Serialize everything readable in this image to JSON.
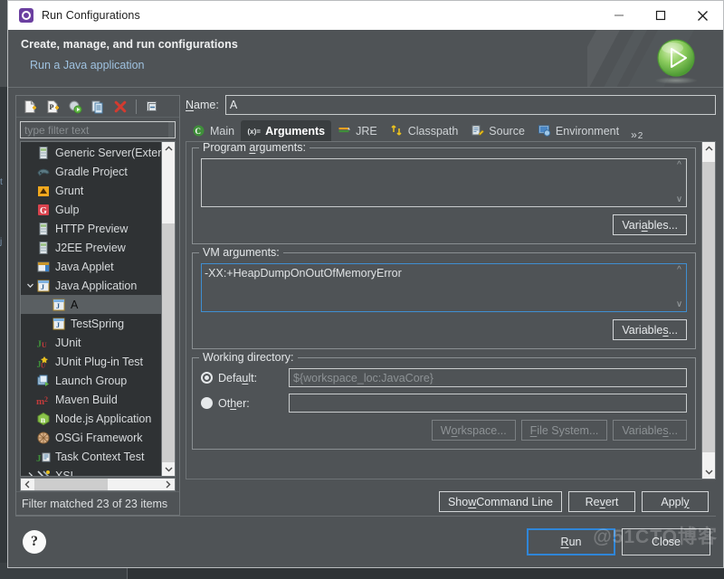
{
  "window": {
    "title": "Run Configurations",
    "icon": "run-configurations-icon",
    "minimize": "minimize-icon",
    "maximize": "maximize-icon",
    "close": "close-icon"
  },
  "header": {
    "title": "Create, manage, and run configurations",
    "subtitle": "Run a Java application",
    "badge_icon": "green-run-icon"
  },
  "left_panel": {
    "toolbar": [
      {
        "name": "new-launch-configuration",
        "icon": "new-config-icon"
      },
      {
        "name": "new-prototype",
        "icon": "new-prototype-icon"
      },
      {
        "name": "export-launch-configuration",
        "icon": "export-icon"
      },
      {
        "name": "duplicate-launch-configuration",
        "icon": "duplicate-icon"
      },
      {
        "name": "delete-launch-configuration",
        "icon": "delete-icon"
      },
      {
        "name": "collapse-all",
        "icon": "collapse-all-icon"
      }
    ],
    "filter": {
      "value": "",
      "placeholder": "type filter text"
    },
    "tree": [
      {
        "label": "Generic Server(External Launch)",
        "icon": "server-icon",
        "indent": 0,
        "twisty": "",
        "selected": false
      },
      {
        "label": "Gradle Project",
        "icon": "gradle-icon",
        "indent": 0,
        "twisty": "",
        "selected": false
      },
      {
        "label": "Grunt",
        "icon": "grunt-icon",
        "indent": 0,
        "twisty": "",
        "selected": false
      },
      {
        "label": "Gulp",
        "icon": "gulp-icon",
        "indent": 0,
        "twisty": "",
        "selected": false
      },
      {
        "label": "HTTP Preview",
        "icon": "server-icon",
        "indent": 0,
        "twisty": "",
        "selected": false
      },
      {
        "label": "J2EE Preview",
        "icon": "server-icon",
        "indent": 0,
        "twisty": "",
        "selected": false
      },
      {
        "label": "Java Applet",
        "icon": "java-applet-icon",
        "indent": 0,
        "twisty": "",
        "selected": false
      },
      {
        "label": "Java Application",
        "icon": "java-application-icon",
        "indent": 0,
        "twisty": "expanded",
        "selected": false
      },
      {
        "label": "A",
        "icon": "java-launch-icon",
        "indent": 1,
        "twisty": "",
        "selected": true
      },
      {
        "label": "TestSpring",
        "icon": "java-launch-icon",
        "indent": 1,
        "twisty": "",
        "selected": false
      },
      {
        "label": "JUnit",
        "icon": "junit-icon",
        "indent": 0,
        "twisty": "",
        "selected": false
      },
      {
        "label": "JUnit Plug-in Test",
        "icon": "junit-plugin-icon",
        "indent": 0,
        "twisty": "",
        "selected": false
      },
      {
        "label": "Launch Group",
        "icon": "launch-group-icon",
        "indent": 0,
        "twisty": "",
        "selected": false
      },
      {
        "label": "Maven Build",
        "icon": "maven-icon",
        "indent": 0,
        "twisty": "",
        "selected": false
      },
      {
        "label": "Node.js Application",
        "icon": "nodejs-icon",
        "indent": 0,
        "twisty": "",
        "selected": false
      },
      {
        "label": "OSGi Framework",
        "icon": "osgi-icon",
        "indent": 0,
        "twisty": "",
        "selected": false
      },
      {
        "label": "Task Context Test",
        "icon": "task-context-icon",
        "indent": 0,
        "twisty": "",
        "selected": false
      },
      {
        "label": "XSL",
        "icon": "xsl-icon",
        "indent": 0,
        "twisty": "collapsed",
        "selected": false
      }
    ],
    "status": "Filter matched 23 of 23 items"
  },
  "right_panel": {
    "name_label": "Name:",
    "name_value": "A",
    "tabs": [
      {
        "label": "Main",
        "icon": "main-tab-icon",
        "active": false
      },
      {
        "label": "Arguments",
        "icon": "arguments-tab-icon",
        "active": true
      },
      {
        "label": "JRE",
        "icon": "jre-tab-icon",
        "active": false
      },
      {
        "label": "Classpath",
        "icon": "classpath-tab-icon",
        "active": false
      },
      {
        "label": "Source",
        "icon": "source-tab-icon",
        "active": false
      },
      {
        "label": "Environment",
        "icon": "environment-tab-icon",
        "active": false
      }
    ],
    "tab_overflow": {
      "chevron": "»",
      "count": "2"
    },
    "program_arguments": {
      "label": "Program arguments:",
      "value": "",
      "variables_button": "Variables..."
    },
    "vm_arguments": {
      "label": "VM arguments:",
      "value": "-XX:+HeapDumpOnOutOfMemoryError",
      "variables_button": "Variables...",
      "focused": true
    },
    "working_directory": {
      "label": "Working directory:",
      "default_label": "Default:",
      "default_value": "${workspace_loc:JavaCore}",
      "default_selected": true,
      "other_label": "Other:",
      "other_value": "",
      "buttons": [
        "Workspace...",
        "File System...",
        "Variables..."
      ]
    }
  },
  "actions": {
    "show_command_line": "Show Command Line",
    "revert": "Revert",
    "apply": "Apply"
  },
  "footer": {
    "help": "?",
    "run": "Run",
    "close": "Close"
  },
  "watermark": "@51CTO博客",
  "colors": {
    "dialog_bg": "#4f5356",
    "tree_bg": "#2f3234",
    "accent_blue": "#2f86d8",
    "link_blue": "#9fc2e0",
    "delete_red": "#d23b30",
    "run_green": "#63b649"
  }
}
